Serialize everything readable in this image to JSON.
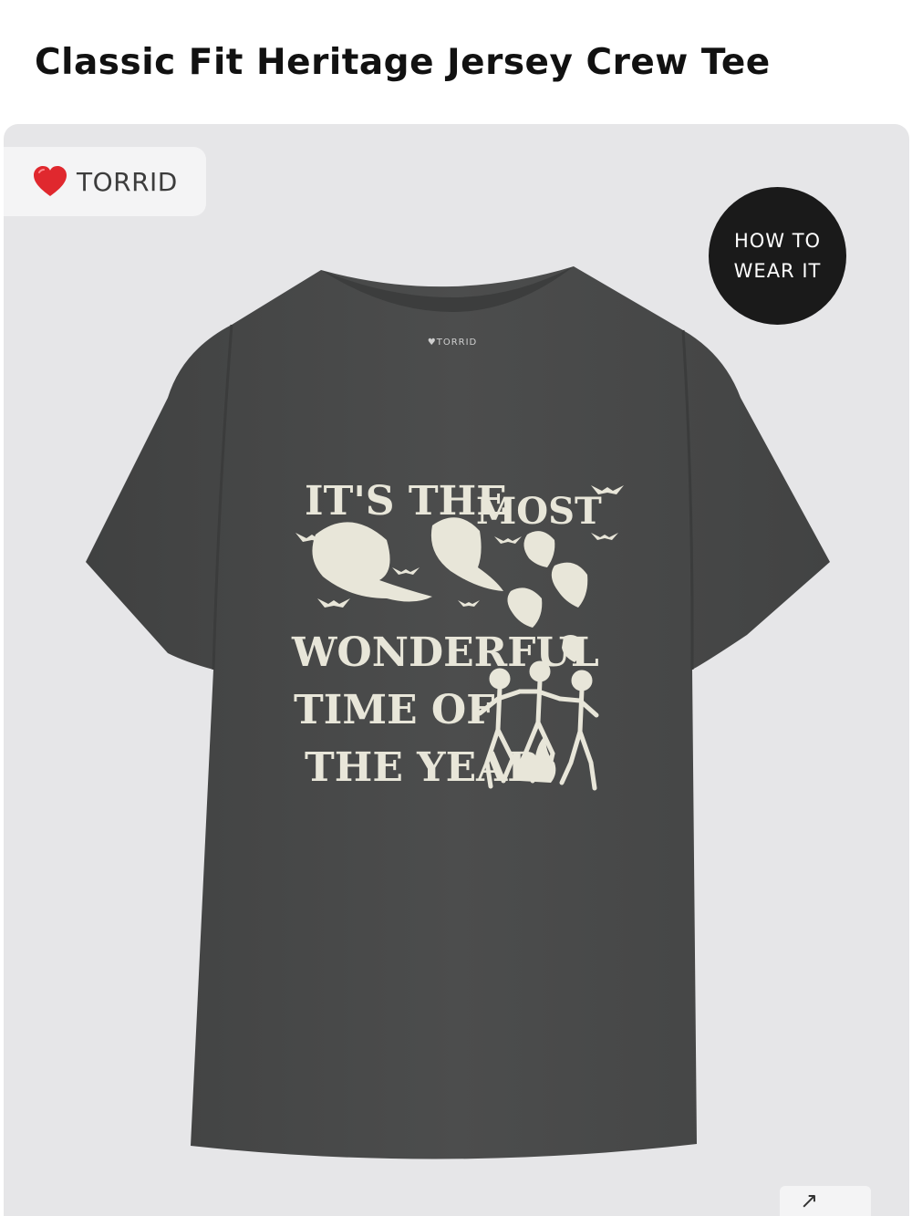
{
  "product": {
    "title": "Classic Fit Heritage Jersey Crew Tee"
  },
  "gallery": {
    "brand_badge": {
      "label": "TORRID",
      "icon": "heart-icon"
    },
    "how_to_wear": {
      "line1": "HOW TO",
      "line2": "WEAR IT"
    },
    "zoom_glyph": "↗",
    "tee": {
      "collar_label": "♥TORRID",
      "print_lines": [
        "IT'S THE",
        "MOST",
        "WONDERFUL",
        "TIME OF",
        "THE YEAR"
      ]
    }
  },
  "colors": {
    "tee": "#4a4b4b",
    "print": "#e8e6d9",
    "background": "#e6e6e8",
    "badge": "#1a1a1a",
    "heart": "#e0282e"
  }
}
